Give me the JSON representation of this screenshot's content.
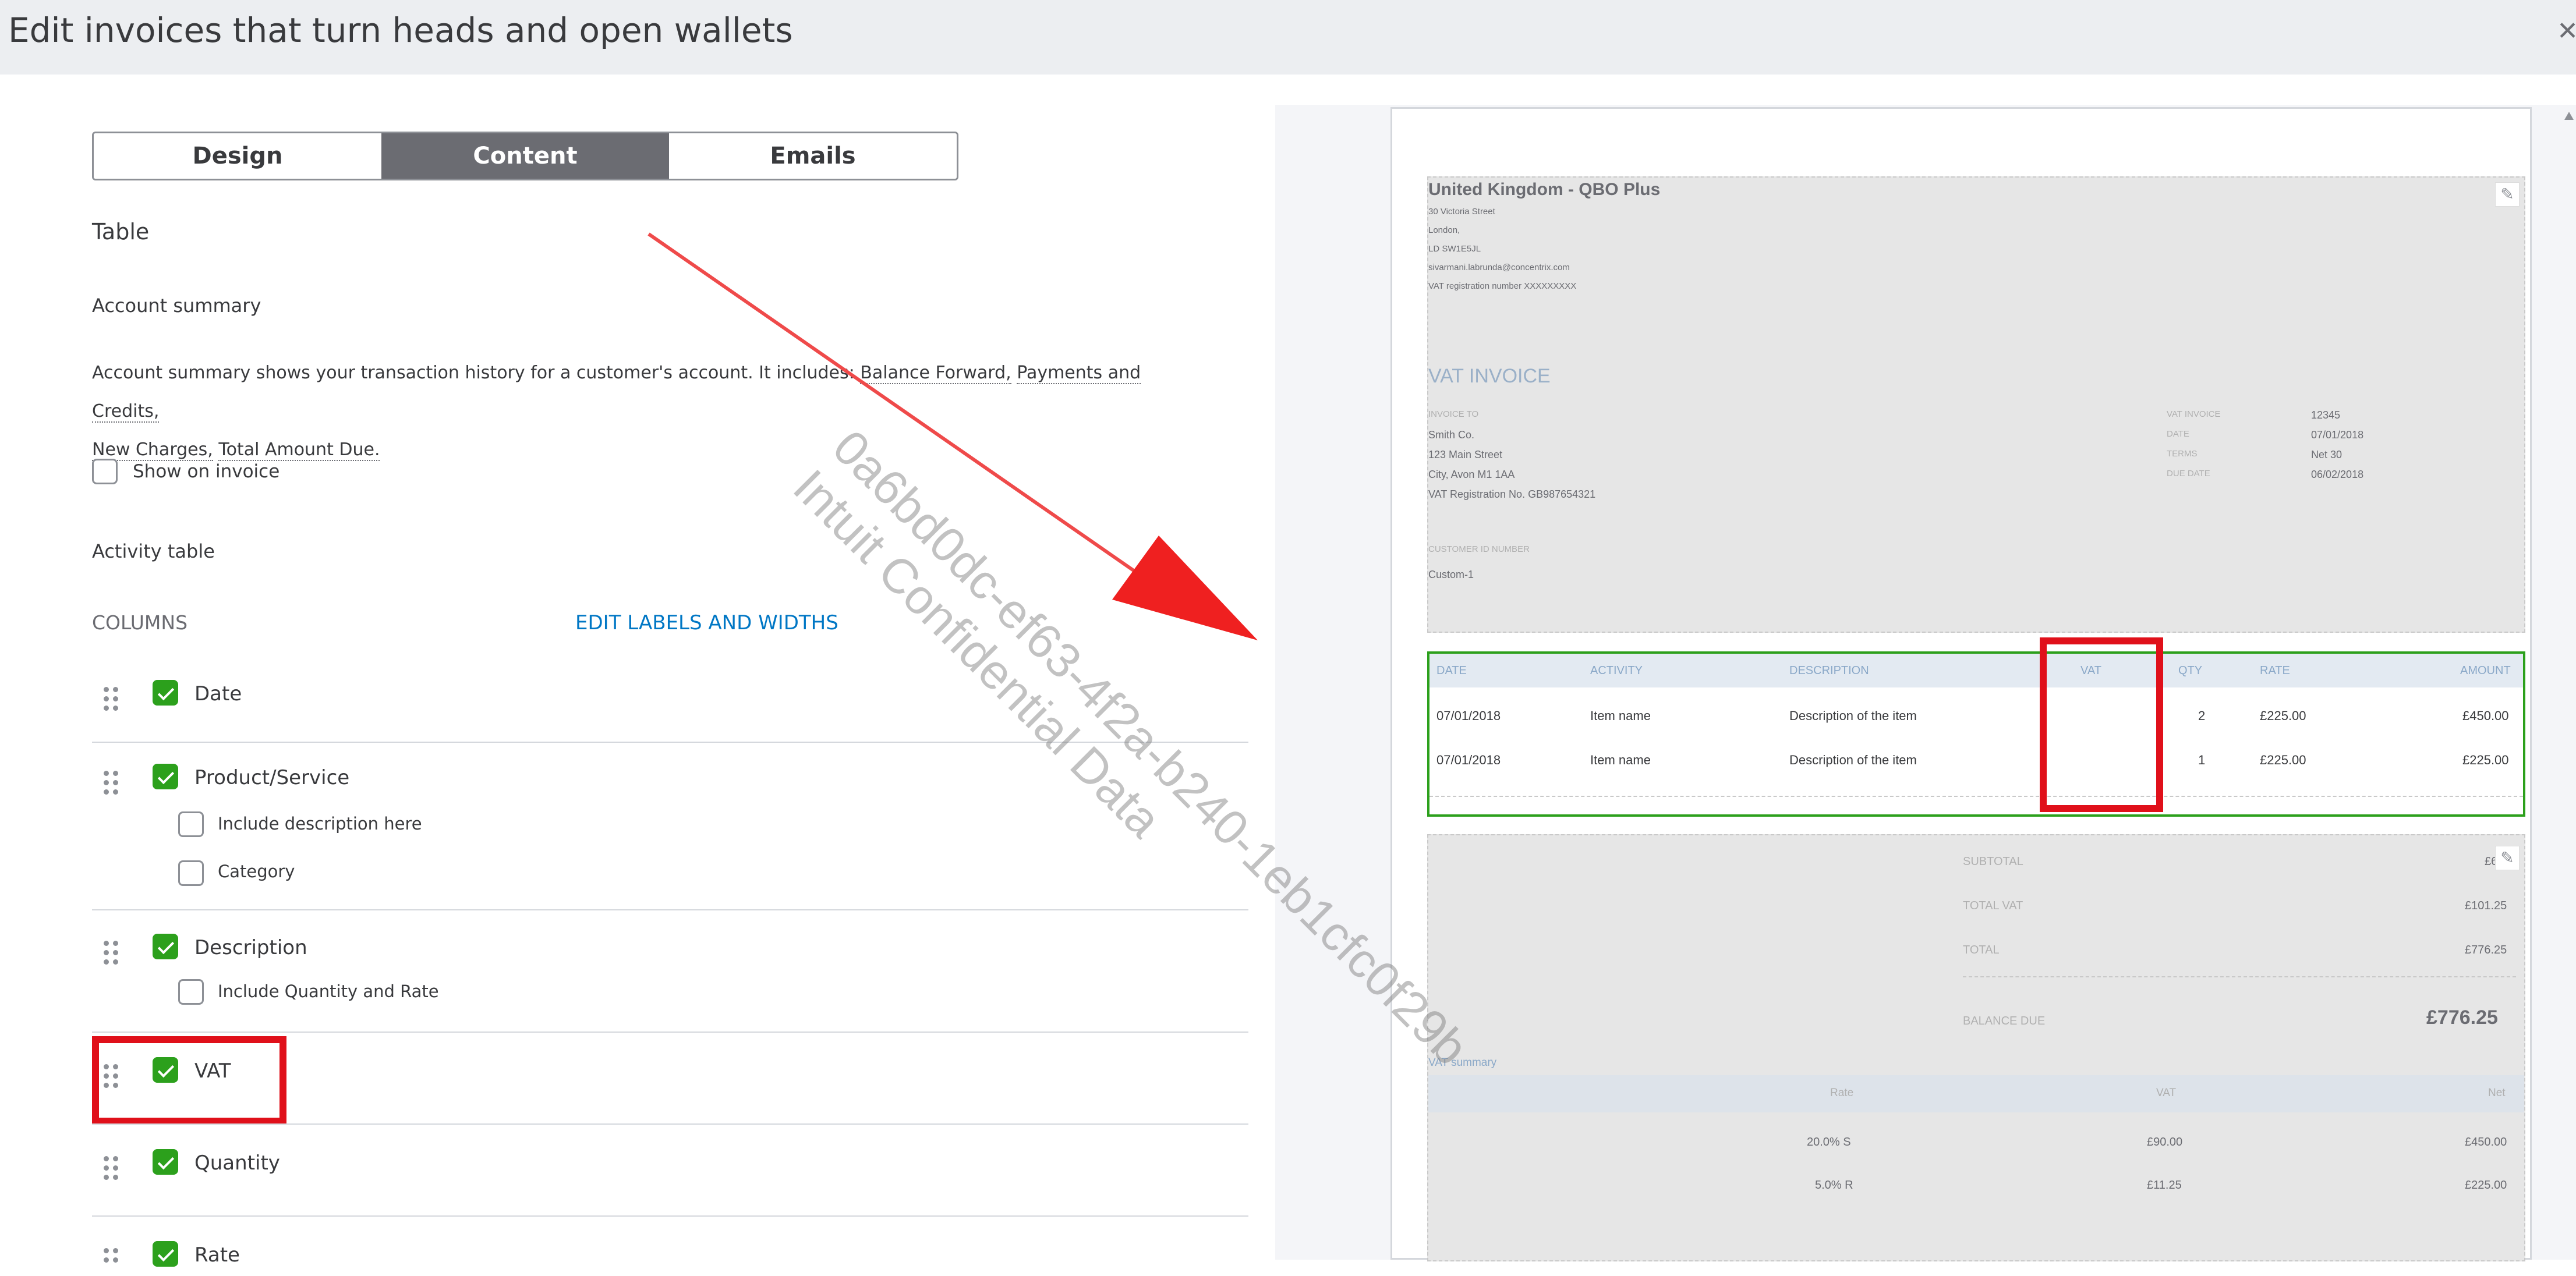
{
  "header": {
    "title": "Edit invoices that turn heads and open wallets",
    "close_icon": "close-icon"
  },
  "tabs": [
    {
      "label": "Design"
    },
    {
      "label": "Content",
      "active": true
    },
    {
      "label": "Emails"
    }
  ],
  "section": {
    "table_label": "Table",
    "account_summary": "Account summary",
    "desc_prefix": "Account summary shows your transaction history for a customer's account. It includes: ",
    "desc_terms": [
      "Balance Forward,",
      "Payments and Credits,",
      "New Charges,",
      "Total Amount Due."
    ],
    "show_on_invoice": "Show on invoice",
    "activity_table": "Activity table",
    "columns_label": "COLUMNS",
    "edit_labels_link": "EDIT LABELS AND WIDTHS"
  },
  "columns": [
    {
      "label": "Date",
      "checked": true
    },
    {
      "label": "Product/Service",
      "checked": true,
      "subs": [
        {
          "label": "Include description here",
          "checked": false
        },
        {
          "label": "Category",
          "checked": false
        }
      ]
    },
    {
      "label": "Description",
      "checked": true,
      "subs": [
        {
          "label": "Include Quantity and Rate",
          "checked": false
        }
      ]
    },
    {
      "label": "VAT",
      "checked": true
    },
    {
      "label": "Quantity",
      "checked": true
    },
    {
      "label": "Rate",
      "checked": true
    }
  ],
  "watermark": {
    "line1": "0a6bd0dc-ef63-4f2a-b240-1eb1cfc0f29b",
    "line2": "Intuit Confidential Data"
  },
  "invoice": {
    "company": "United Kingdom - QBO Plus",
    "address_lines": [
      "30 Victoria Street",
      "London,",
      "LD SW1E5JL",
      "sivarmani.labrunda@concentrix.com",
      "VAT registration number XXXXXXXXX"
    ],
    "heading": "VAT INVOICE",
    "invoice_to_label": "INVOICE TO",
    "invoice_to": [
      "Smith Co.",
      "123 Main Street",
      "City, Avon M1 1AA",
      "VAT Registration No. GB987654321"
    ],
    "meta": [
      {
        "label": "VAT INVOICE",
        "value": "12345"
      },
      {
        "label": "DATE",
        "value": "07/01/2018"
      },
      {
        "label": "TERMS",
        "value": "Net 30"
      },
      {
        "label": "DUE DATE",
        "value": "06/02/2018"
      }
    ],
    "customer_id_label": "CUSTOMER ID NUMBER",
    "customer_id": "Custom-1",
    "table_headers": [
      "DATE",
      "ACTIVITY",
      "DESCRIPTION",
      "VAT",
      "QTY",
      "RATE",
      "AMOUNT"
    ],
    "rows": [
      [
        "07/01/2018",
        "Item name",
        "Description of the item",
        "",
        "2",
        "£225.00",
        "£450.00"
      ],
      [
        "07/01/2018",
        "Item name",
        "Description of the item",
        "",
        "1",
        "£225.00",
        "£225.00"
      ]
    ],
    "totals": [
      {
        "label": "SUBTOTAL",
        "value": "£675"
      },
      {
        "label": "TOTAL VAT",
        "value": "£101.25"
      },
      {
        "label": "TOTAL",
        "value": "£776.25"
      }
    ],
    "balance_due_label": "BALANCE DUE",
    "balance_due": "£776.25",
    "vat_summary_label": "VAT summary",
    "vat_summary_headers": [
      "Rate",
      "VAT",
      "Net"
    ],
    "vat_summary_rows": [
      [
        "20.0% S",
        "£90.00",
        "£450.00"
      ],
      [
        "5.0% R",
        "£11.25",
        "£225.00"
      ]
    ]
  },
  "colors": {
    "accent_green": "#2ca01c",
    "link_blue": "#0077c5",
    "annotation_red": "#e0101a"
  }
}
